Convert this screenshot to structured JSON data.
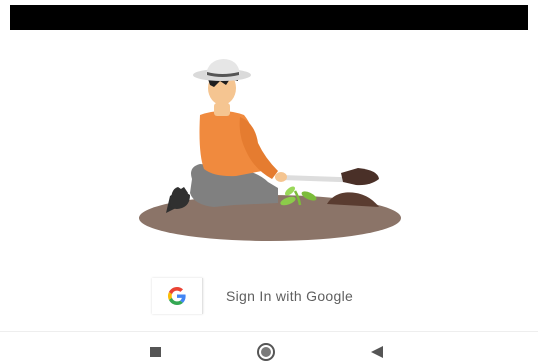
{
  "signin": {
    "button_label": "Sign In with Google"
  },
  "illustration": {
    "description": "gardener-digging"
  },
  "navbar": {
    "recent": "recent-apps-icon",
    "home": "home-icon",
    "back": "back-icon"
  },
  "colors": {
    "status_bar": "#000000",
    "ground": "#8b7468",
    "shirt": "#f08a3e",
    "pants": "#808080",
    "label_text": "#5f5f5f",
    "nav_icons": "#555555"
  }
}
